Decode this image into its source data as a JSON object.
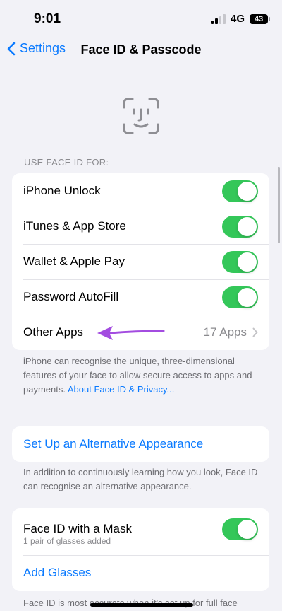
{
  "status_bar": {
    "time": "9:01",
    "network": "4G",
    "battery": "43"
  },
  "nav": {
    "back_label": "Settings",
    "title": "Face ID & Passcode"
  },
  "face_id_section": {
    "header": "USE FACE ID FOR:",
    "rows": [
      {
        "label": "iPhone Unlock",
        "toggle": "on"
      },
      {
        "label": "iTunes & App Store",
        "toggle": "on"
      },
      {
        "label": "Wallet & Apple Pay",
        "toggle": "on"
      },
      {
        "label": "Password AutoFill",
        "toggle": "on"
      },
      {
        "label": "Other Apps",
        "value": "17 Apps"
      }
    ],
    "footer_text": "iPhone can recognise the unique, three-dimensional features of your face to allow secure access to apps and payments. ",
    "footer_link": "About Face ID & Privacy..."
  },
  "alternative": {
    "label": "Set Up an Alternative Appearance",
    "footer": "In addition to continuously learning how you look, Face ID can recognise an alternative appearance."
  },
  "mask": {
    "label": "Face ID with a Mask",
    "toggle": "on",
    "subtitle": "1 pair of glasses added",
    "add_glasses": "Add Glasses",
    "footer": "Face ID is most accurate when it's set up for full face"
  },
  "annotation": {
    "color": "#a34ce0"
  },
  "colors": {
    "accent": "#0a7aff",
    "toggle_on": "#34c759",
    "background": "#f2f2f7"
  }
}
